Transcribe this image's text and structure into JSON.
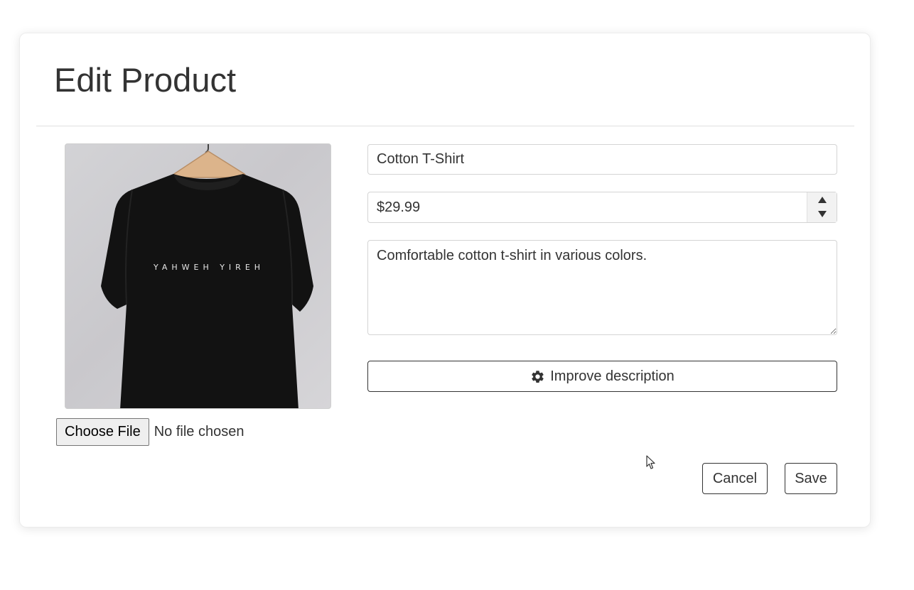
{
  "dialog": {
    "title": "Edit Product"
  },
  "product": {
    "image": {
      "shirt_print_text": "YAHWEH YIREH",
      "shirt_color": "#111111"
    },
    "file_input": {
      "button_label": "Choose File",
      "status": "No file chosen"
    },
    "name": "Cotton T-Shirt",
    "price": "$29.99",
    "description": "Comfortable cotton t-shirt in various colors."
  },
  "actions": {
    "improve_label": "Improve description",
    "improve_icon": "gear-icon",
    "cancel_label": "Cancel",
    "save_label": "Save"
  },
  "colors": {
    "text": "#333333",
    "border": "#d4d4d4",
    "button_border": "#333333"
  }
}
